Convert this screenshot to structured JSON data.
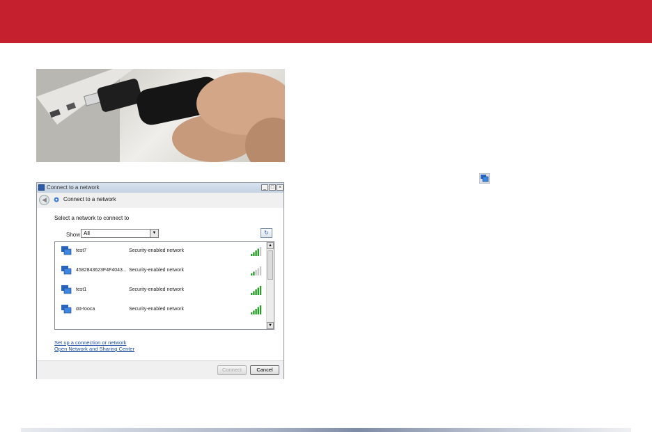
{
  "dialog": {
    "window_title": "Connect to a network",
    "nav_title": "Connect to a network",
    "heading": "Select a network to connect to",
    "show_label": "Show",
    "show_value": "All",
    "networks": [
      {
        "name": "test7",
        "security": "Security-enabled network",
        "signal_bars": 4
      },
      {
        "name": "4582843623F4F4043...",
        "security": "Security-enabled network",
        "signal_bars": 2
      },
      {
        "name": "test1",
        "security": "Security-enabled network",
        "signal_bars": 5
      },
      {
        "name": "dd-fooca",
        "security": "Security-enabled network",
        "signal_bars": 5
      }
    ],
    "links": {
      "setup": "Set up a connection or network",
      "sharing_center": "Open Network and Sharing Center"
    },
    "buttons": {
      "connect": "Connect",
      "cancel": "Cancel"
    }
  },
  "colors": {
    "banner": "#c4202e",
    "link": "#1a4ba0",
    "signal_on": "#2e9a2e",
    "signal_off": "#c8c8c8"
  },
  "icons": {
    "photo": "usb-adapter-photo",
    "tray": "network-tray-icon"
  }
}
